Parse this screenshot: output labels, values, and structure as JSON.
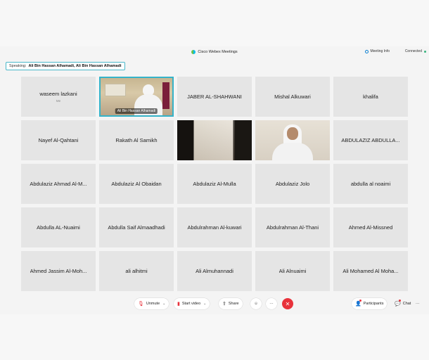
{
  "window": {
    "title": "Cisco Webex Meetings",
    "meeting_info_label": "Meeting Info",
    "status": "Connected"
  },
  "speaking": {
    "label": "Speaking:",
    "names": "Ali Bin Hassan Alhamadi,   Ali Bin Hassan Alhamadi"
  },
  "participants": [
    {
      "name": "waseem lazkani",
      "sub": "Me"
    },
    {
      "name": "Ali Bin Hassan Alhamadi",
      "video": "room",
      "active": true
    },
    {
      "name": "JABER AL-SHAHWANI"
    },
    {
      "name": "Mishal Alkuwari"
    },
    {
      "name": "khalifa"
    },
    {
      "name": "Nayef Al-Qahtani"
    },
    {
      "name": "Rakath Al Samikh"
    },
    {
      "name": "",
      "video": "dark"
    },
    {
      "name": "",
      "video": "man"
    },
    {
      "name": "ABDULAZIZ ABDULLA..."
    },
    {
      "name": "Abdulaziz Ahmad Al-M..."
    },
    {
      "name": "Abdulaziz Al Obaidan"
    },
    {
      "name": "Abdulaziz Al-Mulla"
    },
    {
      "name": "Abdulaziz Jolo"
    },
    {
      "name": "abdulla al noaimi"
    },
    {
      "name": "Abdulla AL-Nuaimi"
    },
    {
      "name": "Abdulla Saif Almaadhadi"
    },
    {
      "name": "Abdulrahman Al-kuwari"
    },
    {
      "name": "Abdulrahman Al-Thani"
    },
    {
      "name": "Ahmed Al-Missned"
    },
    {
      "name": "Ahmed Jassim Al-Moh..."
    },
    {
      "name": "ali alhitmi"
    },
    {
      "name": "Ali Almuhannadi"
    },
    {
      "name": "Ali Alnuaimi"
    },
    {
      "name": "Ali Mohamed Al Moha..."
    }
  ],
  "toolbar": {
    "unmute": "Unmute",
    "start_video": "Start video",
    "share": "Share",
    "participants": "Participants",
    "chat": "Chat"
  },
  "colors": {
    "accent": "#35b3c9",
    "leave": "#e8323b",
    "connected": "#36b37e"
  }
}
